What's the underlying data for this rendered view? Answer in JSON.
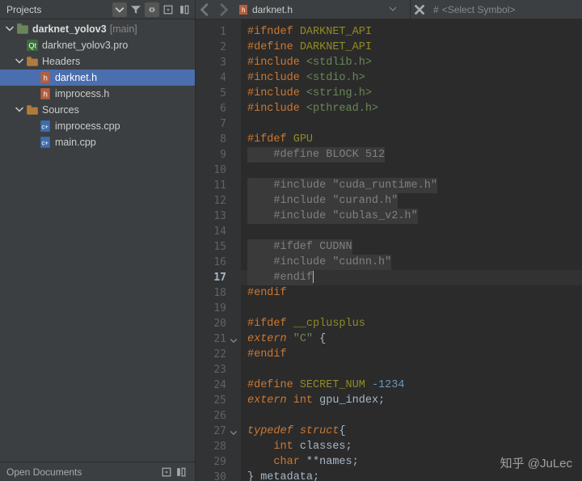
{
  "sidebar": {
    "title": "Projects",
    "tree": {
      "project": {
        "label": "darknet_yolov3",
        "tag": "[main]"
      },
      "pro_file": "darknet_yolov3.pro",
      "headers": {
        "label": "Headers",
        "items": [
          "darknet.h",
          "improcess.h"
        ],
        "selected": 0
      },
      "sources": {
        "label": "Sources",
        "items": [
          "improcess.cpp",
          "main.cpp"
        ]
      }
    },
    "footer": "Open Documents"
  },
  "editor": {
    "filename": "darknet.h",
    "symbol_placeholder": "<Select Symbol>",
    "current_line": 17,
    "fold_lines": [
      21,
      27
    ],
    "lines": [
      [
        {
          "c": "pp",
          "t": "#ifndef"
        },
        {
          "c": "",
          "t": " "
        },
        {
          "c": "mac",
          "t": "DARKNET_API"
        }
      ],
      [
        {
          "c": "pp",
          "t": "#define"
        },
        {
          "c": "",
          "t": " "
        },
        {
          "c": "mac",
          "t": "DARKNET_API"
        }
      ],
      [
        {
          "c": "pp",
          "t": "#include"
        },
        {
          "c": "",
          "t": " "
        },
        {
          "c": "str",
          "t": "<stdlib.h>"
        }
      ],
      [
        {
          "c": "pp",
          "t": "#include"
        },
        {
          "c": "",
          "t": " "
        },
        {
          "c": "str",
          "t": "<stdio.h>"
        }
      ],
      [
        {
          "c": "pp",
          "t": "#include"
        },
        {
          "c": "",
          "t": " "
        },
        {
          "c": "str",
          "t": "<string.h>"
        }
      ],
      [
        {
          "c": "pp",
          "t": "#include"
        },
        {
          "c": "",
          "t": " "
        },
        {
          "c": "str",
          "t": "<pthread.h>"
        }
      ],
      [],
      [
        {
          "c": "pp",
          "t": "#ifdef"
        },
        {
          "c": "",
          "t": " "
        },
        {
          "c": "mac",
          "t": "GPU"
        }
      ],
      [
        {
          "c": "cm",
          "t": "    #define BLOCK 512"
        }
      ],
      [],
      [
        {
          "c": "cm",
          "t": "    #include \"cuda_runtime.h\""
        }
      ],
      [
        {
          "c": "cm",
          "t": "    #include \"curand.h\""
        }
      ],
      [
        {
          "c": "cm",
          "t": "    #include \"cublas_v2.h\""
        }
      ],
      [],
      [
        {
          "c": "cm",
          "t": "    #ifdef CUDNN"
        }
      ],
      [
        {
          "c": "cm",
          "t": "    #include \"cudnn.h\""
        }
      ],
      [
        {
          "c": "cm",
          "t": "    #endif"
        }
      ],
      [
        {
          "c": "pp",
          "t": "#endif"
        }
      ],
      [],
      [
        {
          "c": "pp",
          "t": "#ifdef"
        },
        {
          "c": "",
          "t": " "
        },
        {
          "c": "mac",
          "t": "__cplusplus"
        }
      ],
      [
        {
          "c": "kw",
          "t": "extern"
        },
        {
          "c": "",
          "t": " "
        },
        {
          "c": "str",
          "t": "\"C\""
        },
        {
          "c": "",
          "t": " "
        },
        {
          "c": "id",
          "t": "{"
        }
      ],
      [
        {
          "c": "pp",
          "t": "#endif"
        }
      ],
      [],
      [
        {
          "c": "pp",
          "t": "#define"
        },
        {
          "c": "",
          "t": " "
        },
        {
          "c": "mac",
          "t": "SECRET_NUM"
        },
        {
          "c": "",
          "t": " "
        },
        {
          "c": "num",
          "t": "-1234"
        }
      ],
      [
        {
          "c": "kw",
          "t": "extern"
        },
        {
          "c": "",
          "t": " "
        },
        {
          "c": "kw2",
          "t": "int"
        },
        {
          "c": "",
          "t": " "
        },
        {
          "c": "id",
          "t": "gpu_index;"
        }
      ],
      [],
      [
        {
          "c": "kw",
          "t": "typedef"
        },
        {
          "c": "",
          "t": " "
        },
        {
          "c": "kw",
          "t": "struct"
        },
        {
          "c": "id",
          "t": "{"
        }
      ],
      [
        {
          "c": "",
          "t": "    "
        },
        {
          "c": "kw2",
          "t": "int"
        },
        {
          "c": "",
          "t": " "
        },
        {
          "c": "id",
          "t": "classes;"
        }
      ],
      [
        {
          "c": "",
          "t": "    "
        },
        {
          "c": "kw2",
          "t": "char"
        },
        {
          "c": "",
          "t": " "
        },
        {
          "c": "id",
          "t": "**names;"
        }
      ],
      [
        {
          "c": "id",
          "t": "} metadata;"
        }
      ]
    ]
  },
  "watermark": "知乎 @JuLec"
}
